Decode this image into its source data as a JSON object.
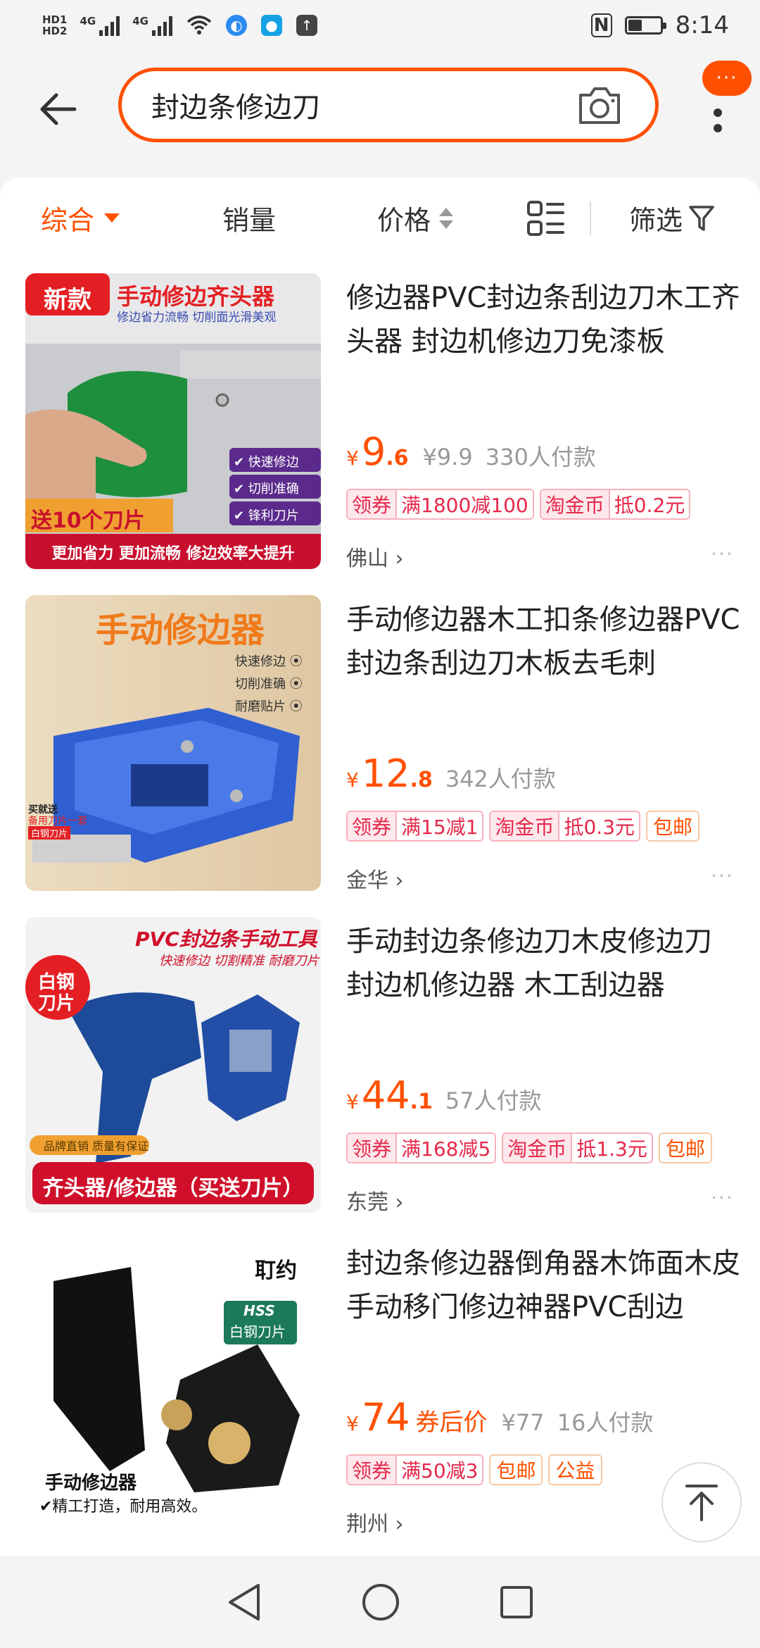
{
  "status": {
    "hd_top": "HD1",
    "hd_bottom": "HD2",
    "net1": "4G",
    "net2": "4G",
    "nfc": "N",
    "time": "8:14",
    "battery_level": 0.45
  },
  "search": {
    "query": "封边条修边刀",
    "more_label": "···"
  },
  "sort": {
    "comprehensive": "综合",
    "sales": "销量",
    "price": "价格",
    "filter": "筛选"
  },
  "products": [
    {
      "title": "修边器PVC封边条刮边刀木工齐头器 封边机修边刀免漆板",
      "yen": "¥",
      "price_int": "9",
      "price_dec": ".6",
      "price_note": "",
      "old_price": "¥9.9",
      "sold": "330人付款",
      "tags": [
        {
          "label": "领券",
          "value": "满1800减100"
        },
        {
          "label": "淘金币",
          "value": "抵0.2元"
        }
      ],
      "extra_tags": [],
      "location": "佛山 ›",
      "more": "···",
      "img": {
        "badge": "新款",
        "headline": "手动修边齐头器",
        "subline": "修边省力流畅 切削面光滑美观",
        "features": [
          "✔ 快速修边",
          "✔ 切削准确",
          "✔ 锋利刀片"
        ],
        "promo": "送10个刀片",
        "footer": "更加省力 更加流畅 修边效率大提升"
      }
    },
    {
      "title": "手动修边器木工扣条修边器PVC封边条刮边刀木板去毛刺",
      "yen": "¥",
      "price_int": "12",
      "price_dec": ".8",
      "price_note": "",
      "old_price": "",
      "sold": "342人付款",
      "tags": [
        {
          "label": "领券",
          "value": "满15减1"
        },
        {
          "label": "淘金币",
          "value": "抵0.3元"
        }
      ],
      "extra_tags": [
        "包邮"
      ],
      "location": "金华 ›",
      "more": "···",
      "img": {
        "headline": "手动修边器",
        "features": [
          "快速修边 ⦿",
          "切削准确 ⦿",
          "耐磨贴片 ⦿"
        ],
        "gift1": "买就送",
        "gift2": "备用刀片一套",
        "gift3": "白钢刀片"
      }
    },
    {
      "title": "手动封边条修边刀木皮修边刀 封边机修边器 木工刮边器",
      "yen": "¥",
      "price_int": "44",
      "price_dec": ".1",
      "price_note": "",
      "old_price": "",
      "sold": "57人付款",
      "tags": [
        {
          "label": "领券",
          "value": "满168减5"
        },
        {
          "label": "淘金币",
          "value": "抵1.3元"
        }
      ],
      "extra_tags": [
        "包邮"
      ],
      "location": "东莞 ›",
      "more": "···",
      "img": {
        "headline": "PVC封边条手动工具",
        "subline": "快速修边 切割精准 耐磨刀片",
        "badge1": "白钢",
        "badge2": "刀片",
        "quality": "品牌直销 质量有保证",
        "footer": "齐头器/修边器（买送刀片）"
      }
    },
    {
      "title": "封边条修边器倒角器木饰面木皮手动移门修边神器PVC刮边",
      "yen": "¥",
      "price_int": "74",
      "price_dec": "",
      "price_note": "券后价",
      "old_price": "¥77",
      "sold": "16人付款",
      "tags": [
        {
          "label": "领券",
          "value": "满50减3"
        }
      ],
      "extra_tags": [
        "包邮",
        "公益"
      ],
      "location": "荆州 ›",
      "more": "",
      "img": {
        "brand": "耵约",
        "hss": "HSS",
        "hss_sub": "白钢刀片",
        "caption": "手动修边器",
        "caption2": "✔精工打造，耐用高效。"
      }
    }
  ],
  "colors": {
    "accent": "#ff5000",
    "tag_red": "#e6284a",
    "muted": "#999999"
  }
}
